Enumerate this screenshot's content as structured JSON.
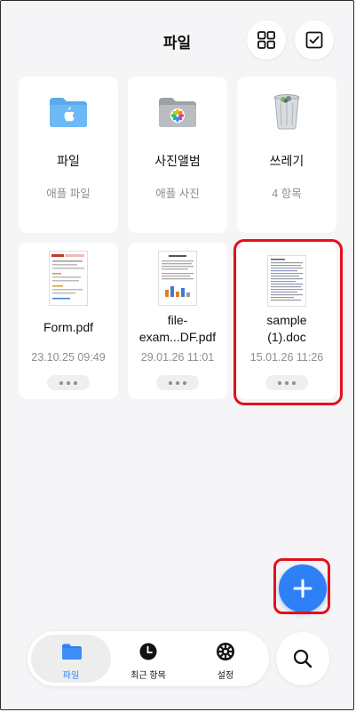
{
  "header": {
    "title": "파일",
    "grid_icon": "grid-icon",
    "select_icon": "checkbox-icon"
  },
  "folders": [
    {
      "name": "파일",
      "sub": "애플 파일",
      "icon": "blue-folder-icon"
    },
    {
      "name": "사진앨범",
      "sub": "애플 사진",
      "icon": "photos-folder-icon"
    },
    {
      "name": "쓰레기",
      "sub": "4 항목",
      "icon": "trash-icon"
    }
  ],
  "files": [
    {
      "name": "Form.pdf",
      "date": "23.10.25 09:49"
    },
    {
      "name_line1": "file-",
      "name_line2": "exam...DF.pdf",
      "date": "29.01.26 11:01"
    },
    {
      "name_line1": "sample",
      "name_line2": "(1).doc",
      "date": "15.01.26 11:26"
    }
  ],
  "fab": {
    "icon": "plus-icon"
  },
  "tabs": [
    {
      "label": "파일",
      "icon": "folder-icon",
      "active": true
    },
    {
      "label": "최근 항목",
      "icon": "clock-icon"
    },
    {
      "label": "설정",
      "icon": "gear-icon"
    }
  ],
  "search": {
    "icon": "search-icon"
  },
  "colors": {
    "accent": "#2f80f6",
    "highlight": "#e3101b",
    "background": "#f5f5f7"
  }
}
